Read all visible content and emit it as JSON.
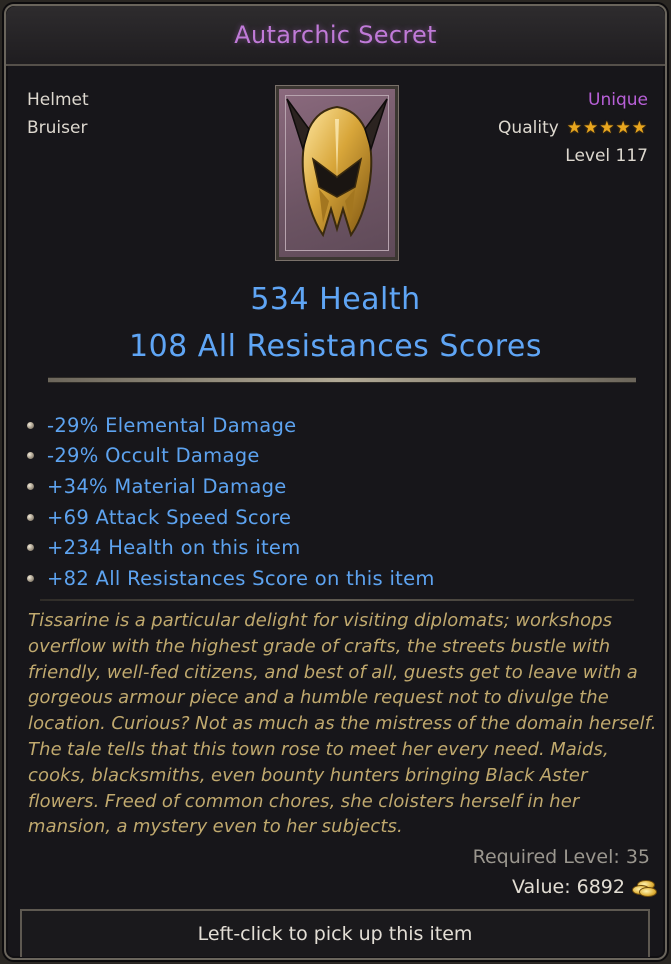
{
  "item": {
    "name": "Autarchic Secret",
    "slot": "Helmet",
    "class": "Bruiser",
    "rarity": "Unique",
    "quality_label": "Quality",
    "quality_stars": "★★★★★",
    "level": "Level 117",
    "image_icon": "helmet-icon"
  },
  "stats": {
    "primary": "534 Health",
    "secondary": "108 All Resistances Scores"
  },
  "mods": [
    "-29% Elemental Damage",
    "-29% Occult Damage",
    "+34% Material Damage",
    "+69 Attack Speed Score",
    "+234 Health on this item",
    "+82 All Resistances Score on this item"
  ],
  "flavor": [
    "Tissarine is a particular delight for visiting diplomats; workshops",
    "overflow with the highest grade of crafts, the streets bustle with",
    "friendly, well-fed citizens, and best of all, guests get to leave with a",
    "gorgeous armour piece and a humble request not to divulge the",
    "location. Curious? Not as much as the mistress of the domain herself.",
    "The tale tells that this town rose to meet her every need. Maids,",
    "cooks, blacksmiths, even bounty hunters bringing Black Aster",
    "flowers. Freed of common chores, she cloisters herself in her",
    "mansion, a mystery even to her subjects."
  ],
  "footer": {
    "required_level": "Required Level: 35",
    "value": "Value: 6892",
    "value_icon": "gold-coins-icon",
    "pickup": "Left-click to pick up this item"
  },
  "colors": {
    "title": "#c07ad8",
    "rarity": "#b860d8",
    "stat": "#5fa5f5",
    "flavor": "#c0a96e",
    "stars": "#e8a61f"
  }
}
